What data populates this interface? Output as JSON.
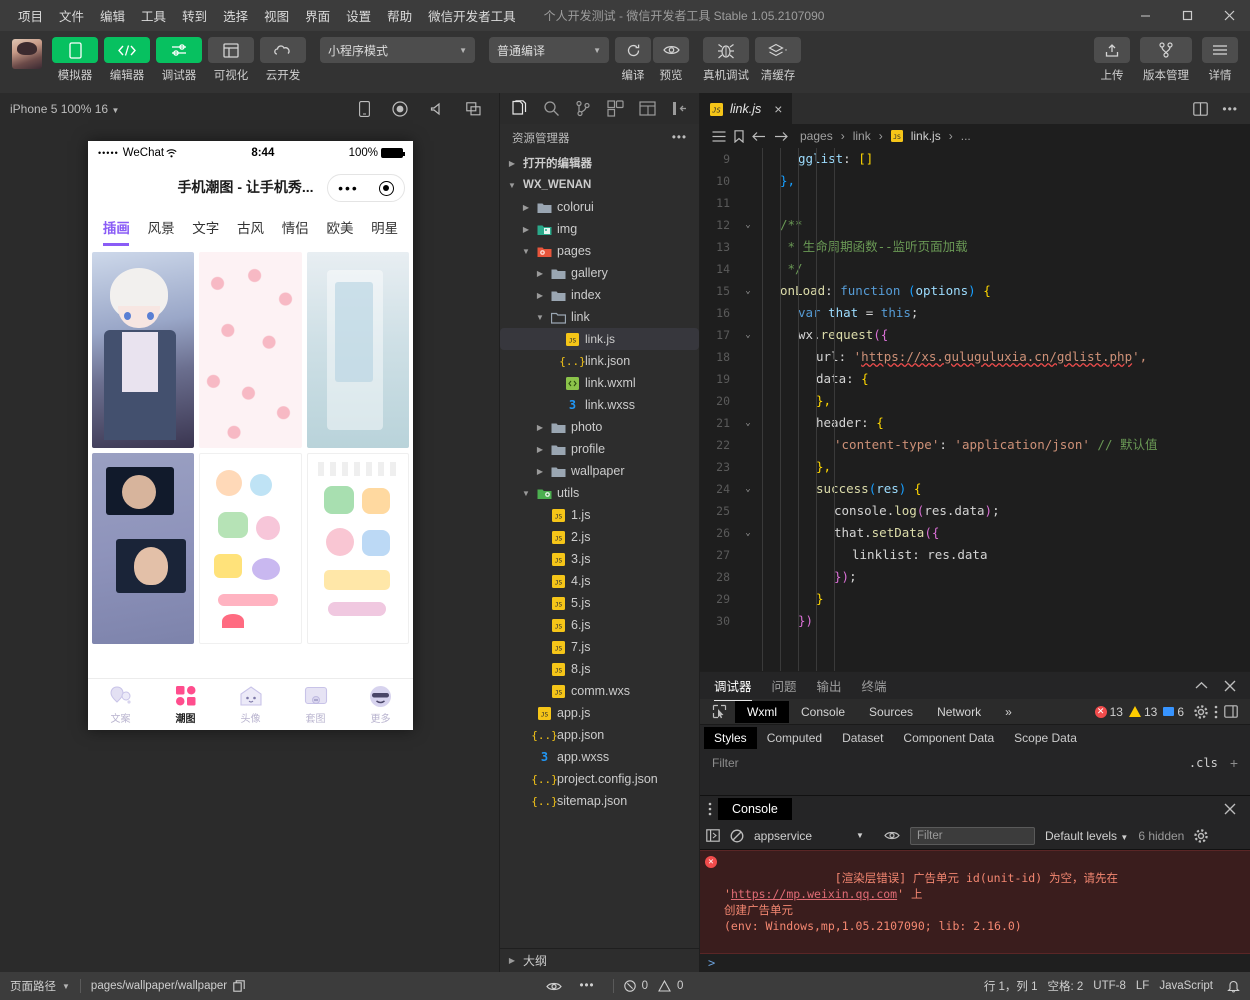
{
  "window": {
    "menu": [
      "项目",
      "文件",
      "编辑",
      "工具",
      "转到",
      "选择",
      "视图",
      "界面",
      "设置",
      "帮助",
      "微信开发者工具"
    ],
    "title": "个人开发测试 - 微信开发者工具 Stable 1.05.2107090",
    "controls": {
      "minimize": "minimize-icon",
      "maximize": "maximize-icon",
      "close": "close-icon"
    }
  },
  "toolbar": {
    "modes": [
      {
        "label": "模拟器",
        "icon": "phone-icon",
        "active": true
      },
      {
        "label": "编辑器",
        "icon": "code-icon",
        "active": true
      },
      {
        "label": "调试器",
        "icon": "debugger-icon",
        "active": true
      },
      {
        "label": "可视化",
        "icon": "layout-icon",
        "active": false
      },
      {
        "label": "云开发",
        "icon": "cloud-icon",
        "active": false
      }
    ],
    "mode_select": "小程序模式",
    "compile_select": "普通编译",
    "actions": [
      {
        "label": "编译",
        "icon": "refresh-icon"
      },
      {
        "label": "预览",
        "icon": "eye-icon"
      },
      {
        "label": "真机调试",
        "icon": "bug-icon"
      },
      {
        "label": "清缓存",
        "icon": "layers-icon"
      }
    ],
    "right_actions": [
      {
        "label": "上传",
        "icon": "upload-icon"
      },
      {
        "label": "版本管理",
        "icon": "branch-icon"
      },
      {
        "label": "详情",
        "icon": "menu-icon"
      }
    ]
  },
  "simulator": {
    "device_label": "iPhone 5 100% 16",
    "icons": [
      "device-icon",
      "record-icon",
      "volume-icon",
      "window-icon"
    ],
    "phone": {
      "carrier": "WeChat",
      "signal_dots": "•••••",
      "time": "8:44",
      "battery": "100%",
      "page_title": "手机潮图 - 让手机秀...",
      "capsule": {
        "more": "•••",
        "target": "target-icon"
      },
      "categories": [
        "插画",
        "风景",
        "文字",
        "古风",
        "情侣",
        "欧美",
        "明星"
      ],
      "active_category": "插画",
      "tabbar": [
        {
          "label": "文案",
          "icon": "balloon-icon",
          "active": false
        },
        {
          "label": "潮图",
          "icon": "grid-icon",
          "active": true
        },
        {
          "label": "头像",
          "icon": "house-icon",
          "active": false
        },
        {
          "label": "套图",
          "icon": "frame-icon",
          "active": false
        },
        {
          "label": "更多",
          "icon": "smiley-icon",
          "active": false
        }
      ]
    }
  },
  "explorer": {
    "sidebar_icons": [
      "files-icon",
      "search-icon",
      "source-control-icon",
      "extensions-icon",
      "wxml-panel-icon",
      "collapse-icon"
    ],
    "title": "资源管理器",
    "more": "•••",
    "sections": [
      {
        "label": "打开的编辑器",
        "expanded": false,
        "type": "section"
      },
      {
        "label": "WX_WENAN",
        "expanded": true,
        "type": "section"
      }
    ],
    "tree": [
      {
        "label": "打开的编辑器",
        "depth": 0,
        "kind": "section",
        "expanded": false
      },
      {
        "label": "WX_WENAN",
        "depth": 0,
        "kind": "root",
        "expanded": true
      },
      {
        "label": "colorui",
        "depth": 1,
        "kind": "folder",
        "expanded": false
      },
      {
        "label": "img",
        "depth": 1,
        "kind": "folder-img",
        "expanded": false
      },
      {
        "label": "pages",
        "depth": 1,
        "kind": "folder-pages",
        "expanded": true
      },
      {
        "label": "gallery",
        "depth": 2,
        "kind": "folder",
        "expanded": false
      },
      {
        "label": "index",
        "depth": 2,
        "kind": "folder",
        "expanded": false
      },
      {
        "label": "link",
        "depth": 2,
        "kind": "folder-open",
        "expanded": true
      },
      {
        "label": "link.js",
        "depth": 3,
        "kind": "js",
        "selected": true
      },
      {
        "label": "link.json",
        "depth": 3,
        "kind": "json"
      },
      {
        "label": "link.wxml",
        "depth": 3,
        "kind": "wxml"
      },
      {
        "label": "link.wxss",
        "depth": 3,
        "kind": "wxss"
      },
      {
        "label": "photo",
        "depth": 2,
        "kind": "folder",
        "expanded": false
      },
      {
        "label": "profile",
        "depth": 2,
        "kind": "folder",
        "expanded": false
      },
      {
        "label": "wallpaper",
        "depth": 2,
        "kind": "folder",
        "expanded": false
      },
      {
        "label": "utils",
        "depth": 1,
        "kind": "folder-utils",
        "expanded": true
      },
      {
        "label": "1.js",
        "depth": 2,
        "kind": "js"
      },
      {
        "label": "2.js",
        "depth": 2,
        "kind": "js"
      },
      {
        "label": "3.js",
        "depth": 2,
        "kind": "js"
      },
      {
        "label": "4.js",
        "depth": 2,
        "kind": "js"
      },
      {
        "label": "5.js",
        "depth": 2,
        "kind": "js"
      },
      {
        "label": "6.js",
        "depth": 2,
        "kind": "js"
      },
      {
        "label": "7.js",
        "depth": 2,
        "kind": "js"
      },
      {
        "label": "8.js",
        "depth": 2,
        "kind": "js"
      },
      {
        "label": "comm.wxs",
        "depth": 2,
        "kind": "js"
      },
      {
        "label": "app.js",
        "depth": 1,
        "kind": "js"
      },
      {
        "label": "app.json",
        "depth": 1,
        "kind": "json"
      },
      {
        "label": "app.wxss",
        "depth": 1,
        "kind": "wxss"
      },
      {
        "label": "project.config.json",
        "depth": 1,
        "kind": "json"
      },
      {
        "label": "sitemap.json",
        "depth": 1,
        "kind": "json"
      }
    ],
    "outline": "大纲"
  },
  "editor": {
    "tab": {
      "label": "link.js",
      "icon": "js-icon",
      "close": "×"
    },
    "tab_right_icons": [
      "split-editor-icon",
      "more-actions-icon"
    ],
    "breadcrumb_icons": [
      "outline-icon",
      "bookmark-icon",
      "back-icon",
      "forward-icon"
    ],
    "breadcrumb": [
      "pages",
      "link",
      "link.js",
      "..."
    ],
    "lines": [
      {
        "n": "9",
        "fold": "",
        "indent": 2,
        "parts": [
          {
            "t": "gglist",
            "c": "k-key"
          },
          {
            "t": ": ",
            "c": "k-pl"
          },
          {
            "t": "[]",
            "c": "k-br"
          }
        ]
      },
      {
        "n": "10",
        "fold": "",
        "indent": 1,
        "parts": [
          {
            "t": "},",
            "c": "k-br3"
          }
        ]
      },
      {
        "n": "11",
        "fold": "",
        "indent": 0,
        "parts": []
      },
      {
        "n": "12",
        "fold": "v",
        "indent": 1,
        "parts": [
          {
            "t": "/**",
            "c": "k-cm"
          }
        ]
      },
      {
        "n": "13",
        "fold": "",
        "indent": 1,
        "parts": [
          {
            "t": " * 生命周期函数--监听页面加载",
            "c": "k-cm"
          }
        ]
      },
      {
        "n": "14",
        "fold": "",
        "indent": 1,
        "parts": [
          {
            "t": " */",
            "c": "k-cm"
          }
        ]
      },
      {
        "n": "15",
        "fold": "v",
        "indent": 1,
        "parts": [
          {
            "t": "onLoad",
            "c": "k-fn"
          },
          {
            "t": ": ",
            "c": "k-pl"
          },
          {
            "t": "function ",
            "c": "k-kw2"
          },
          {
            "t": "(",
            "c": "k-br3"
          },
          {
            "t": "options",
            "c": "k-var"
          },
          {
            "t": ")",
            "c": "k-br3"
          },
          {
            "t": " {",
            "c": "k-br"
          }
        ]
      },
      {
        "n": "16",
        "fold": "",
        "indent": 2,
        "parts": [
          {
            "t": "var ",
            "c": "k-kw2"
          },
          {
            "t": "that",
            "c": "k-var"
          },
          {
            "t": " = ",
            "c": "k-pl"
          },
          {
            "t": "this",
            "c": "k-kw2"
          },
          {
            "t": ";",
            "c": "k-pl"
          }
        ]
      },
      {
        "n": "17",
        "fold": "v",
        "indent": 2,
        "parts": [
          {
            "t": "wx",
            "c": "k-pl"
          },
          {
            "t": ".",
            "c": "k-pl"
          },
          {
            "t": "request",
            "c": "k-fn"
          },
          {
            "t": "({",
            "c": "k-br2"
          }
        ]
      },
      {
        "n": "18",
        "fold": "",
        "indent": 3,
        "parts": [
          {
            "t": "url",
            "c": "k-pl"
          },
          {
            "t": ": ",
            "c": "k-pl"
          },
          {
            "t": "'",
            "c": "k-str"
          },
          {
            "t": "https://xs.guluguluxia.cn/gdlist.php",
            "c": "k-str url-underline"
          },
          {
            "t": "',",
            "c": "k-str"
          }
        ]
      },
      {
        "n": "19",
        "fold": "",
        "indent": 3,
        "parts": [
          {
            "t": "data",
            "c": "k-pl"
          },
          {
            "t": ": ",
            "c": "k-pl"
          },
          {
            "t": "{",
            "c": "k-br"
          }
        ]
      },
      {
        "n": "20",
        "fold": "",
        "indent": 3,
        "parts": [
          {
            "t": "},",
            "c": "k-br"
          }
        ]
      },
      {
        "n": "21",
        "fold": "v",
        "indent": 3,
        "parts": [
          {
            "t": "header",
            "c": "k-pl"
          },
          {
            "t": ": ",
            "c": "k-pl"
          },
          {
            "t": "{",
            "c": "k-br"
          }
        ]
      },
      {
        "n": "22",
        "fold": "",
        "indent": 4,
        "parts": [
          {
            "t": "'content-type'",
            "c": "k-str"
          },
          {
            "t": ": ",
            "c": "k-pl"
          },
          {
            "t": "'application/json'",
            "c": "k-str"
          },
          {
            "t": " // 默认值",
            "c": "k-cm"
          }
        ]
      },
      {
        "n": "23",
        "fold": "",
        "indent": 3,
        "parts": [
          {
            "t": "},",
            "c": "k-br"
          }
        ]
      },
      {
        "n": "24",
        "fold": "v",
        "indent": 3,
        "parts": [
          {
            "t": "success",
            "c": "k-fn"
          },
          {
            "t": "(",
            "c": "k-br3"
          },
          {
            "t": "res",
            "c": "k-var"
          },
          {
            "t": ")",
            "c": "k-br3"
          },
          {
            "t": " {",
            "c": "k-br"
          }
        ]
      },
      {
        "n": "25",
        "fold": "",
        "indent": 4,
        "parts": [
          {
            "t": "console",
            "c": "k-pl"
          },
          {
            "t": ".",
            "c": "k-pl"
          },
          {
            "t": "log",
            "c": "k-fn"
          },
          {
            "t": "(",
            "c": "k-br2"
          },
          {
            "t": "res",
            "c": "k-pl"
          },
          {
            "t": ".data",
            "c": "k-pl"
          },
          {
            "t": ")",
            "c": "k-br2"
          },
          {
            "t": ";",
            "c": "k-pl"
          }
        ]
      },
      {
        "n": "26",
        "fold": "v",
        "indent": 4,
        "parts": [
          {
            "t": "that",
            "c": "k-pl"
          },
          {
            "t": ".",
            "c": "k-pl"
          },
          {
            "t": "setData",
            "c": "k-fn"
          },
          {
            "t": "({",
            "c": "k-br2"
          }
        ]
      },
      {
        "n": "27",
        "fold": "",
        "indent": 5,
        "parts": [
          {
            "t": "linklist",
            "c": "k-pl"
          },
          {
            "t": ": ",
            "c": "k-pl"
          },
          {
            "t": "res.data",
            "c": "k-pl"
          }
        ]
      },
      {
        "n": "28",
        "fold": "",
        "indent": 4,
        "parts": [
          {
            "t": "})",
            "c": "k-br2"
          },
          {
            "t": ";",
            "c": "k-pl"
          }
        ]
      },
      {
        "n": "29",
        "fold": "",
        "indent": 3,
        "parts": [
          {
            "t": "}",
            "c": "k-br"
          }
        ]
      },
      {
        "n": "30",
        "fold": "",
        "indent": 2,
        "parts": [
          {
            "t": "})",
            "c": "k-br2"
          }
        ]
      }
    ]
  },
  "debugger": {
    "panel_tabs": [
      "调试器",
      "问题",
      "输出",
      "终端"
    ],
    "active_panel_tab": "调试器",
    "panel_controls": [
      "chevron-up-icon",
      "close-icon"
    ],
    "devtools_tabs": [
      "Wxml",
      "Console",
      "Sources",
      "Network"
    ],
    "active_devtools_tab": "Wxml",
    "overflow": "»",
    "inspect_icon": "inspect-icon",
    "counters": {
      "errors": "13",
      "warnings": "13",
      "infos": "6"
    },
    "right_icons": [
      "gear-icon",
      "more-vertical-icon",
      "dock-icon"
    ],
    "style_tabs": [
      "Styles",
      "Computed",
      "Dataset",
      "Component Data",
      "Scope Data"
    ],
    "active_style_tab": "Styles",
    "filter_placeholder": "Filter",
    "cls_label": ".cls",
    "plus": "+"
  },
  "console": {
    "title": "Console",
    "drag_icon": "drag-handle-icon",
    "close": "×",
    "toolbar_icons": [
      "sidebar-toggle-icon",
      "clear-console-icon",
      "eye-icon",
      "settings-gear-icon"
    ],
    "context": "appservice",
    "filter_placeholder": "Filter",
    "levels": "Default levels",
    "hidden": "6 hidden",
    "message": {
      "line1_pre": "[渲染层错误] 广告单元 id(unit-id) 为空，请先在 '",
      "link": "https://mp.weixin.qq.com",
      "line1_post": "' 上",
      "line2": "创建广告单元",
      "line3": "(env: Windows,mp,1.05.2107090; lib: 2.16.0)"
    },
    "prompt": ">"
  },
  "statusbar": {
    "page_path_label": "页面路径",
    "page_path": "pages/wallpaper/wallpaper",
    "copy_icon": "copy-icon",
    "eye_icon": "eye-icon",
    "more": "•••",
    "errors": "0",
    "warnings": "0",
    "cursor": "行 1，列 1",
    "spaces": "空格: 2",
    "encoding": "UTF-8",
    "eol": "LF",
    "language": "JavaScript",
    "bell_icon": "bell-icon"
  },
  "colors": {
    "accent_green": "#07c160",
    "accent_purple": "#8a5cf6",
    "error_red": "#f14c4c",
    "warning_yellow": "#ffcc00",
    "info_blue": "#3794ff"
  }
}
